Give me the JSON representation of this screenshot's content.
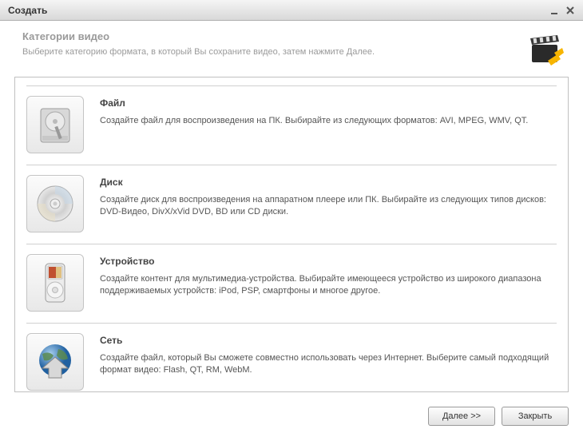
{
  "titlebar": {
    "title": "Создать"
  },
  "header": {
    "title": "Категории видео",
    "subtitle": "Выберите категорию формата, в который Вы сохраните видео, затем нажмите Далее."
  },
  "categories": [
    {
      "id": "file",
      "title": "Файл",
      "desc": "Создайте файл для воспроизведения на ПК. Выбирайте из следующих форматов: AVI, MPEG, WMV, QT."
    },
    {
      "id": "disc",
      "title": "Диск",
      "desc": "Создайте диск для воспроизведения на аппаратном плеере или ПК. Выбирайте из следующих типов дисков: DVD-Видео, DivX/xVid DVD, BD или CD диски."
    },
    {
      "id": "device",
      "title": "Устройство",
      "desc": "Создайте контент для мультимедиа-устройства. Выбирайте имеющееся устройство из широкого диапазона поддерживаемых устройств: iPod, PSP, смартфоны и многое другое."
    },
    {
      "id": "web",
      "title": "Сеть",
      "desc": "Создайте файл, который Вы сможете совместно использовать через Интернет. Выберите самый подходящий формат видео: Flash, QT, RM, WebM."
    }
  ],
  "footer": {
    "next": "Далее >>",
    "close": "Закрыть"
  }
}
